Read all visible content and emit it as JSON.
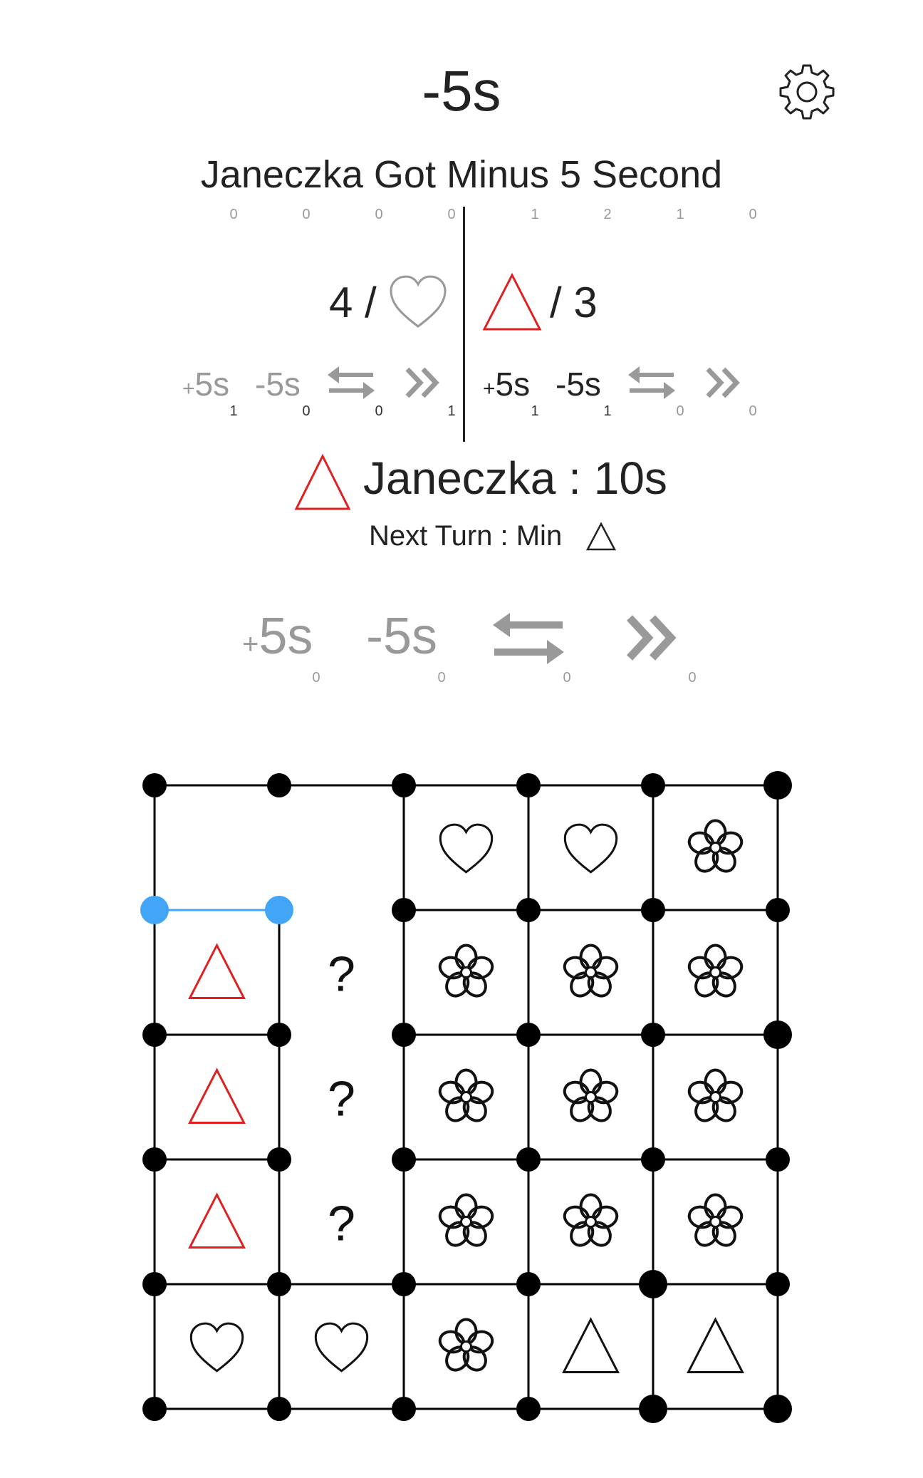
{
  "header": {
    "title": "-5s",
    "message": "Janeczka Got Minus 5 Second"
  },
  "score_left": {
    "text": "4 /",
    "symbol": "heart-icon",
    "counts": [
      "0",
      "0",
      "0",
      "0"
    ],
    "powerups": {
      "plus_sign": "+",
      "plus": "5s",
      "minus": "-5s"
    },
    "powerup_counts": [
      "1",
      "0",
      "0",
      "1"
    ]
  },
  "score_right": {
    "text": "/ 3",
    "symbol": "triangle-icon",
    "symbol_color": "#e02020",
    "counts": [
      "1",
      "2",
      "1",
      "0"
    ],
    "powerups": {
      "plus_sign": "+",
      "plus": "5s",
      "minus": "-5s"
    },
    "powerup_counts": [
      "1",
      "1",
      "0",
      "0"
    ]
  },
  "turn": {
    "player_symbol": "triangle-icon",
    "player_text": "Janeczka : 10s",
    "next_text": "Next Turn : Min",
    "next_symbol": "triangle-outline-icon"
  },
  "controls": {
    "plus_sign": "+",
    "plus": "5s",
    "minus": "-5s",
    "counts": [
      "0",
      "0",
      "0",
      "0"
    ]
  },
  "board": {
    "rows": 5,
    "cols": 5,
    "cells": [
      [
        "empty",
        "empty",
        "heart",
        "heart",
        "flower"
      ],
      [
        "triangle-red",
        "question",
        "flower",
        "flower",
        "flower"
      ],
      [
        "triangle-red",
        "question",
        "flower",
        "flower",
        "flower"
      ],
      [
        "triangle-red",
        "question",
        "flower",
        "flower",
        "flower"
      ],
      [
        "heart",
        "heart",
        "flower",
        "triangle",
        "triangle"
      ]
    ],
    "question_mark": "?",
    "selected_edge_color": "#42a5f5",
    "line_color": "#000000",
    "red_color": "#e02020"
  }
}
